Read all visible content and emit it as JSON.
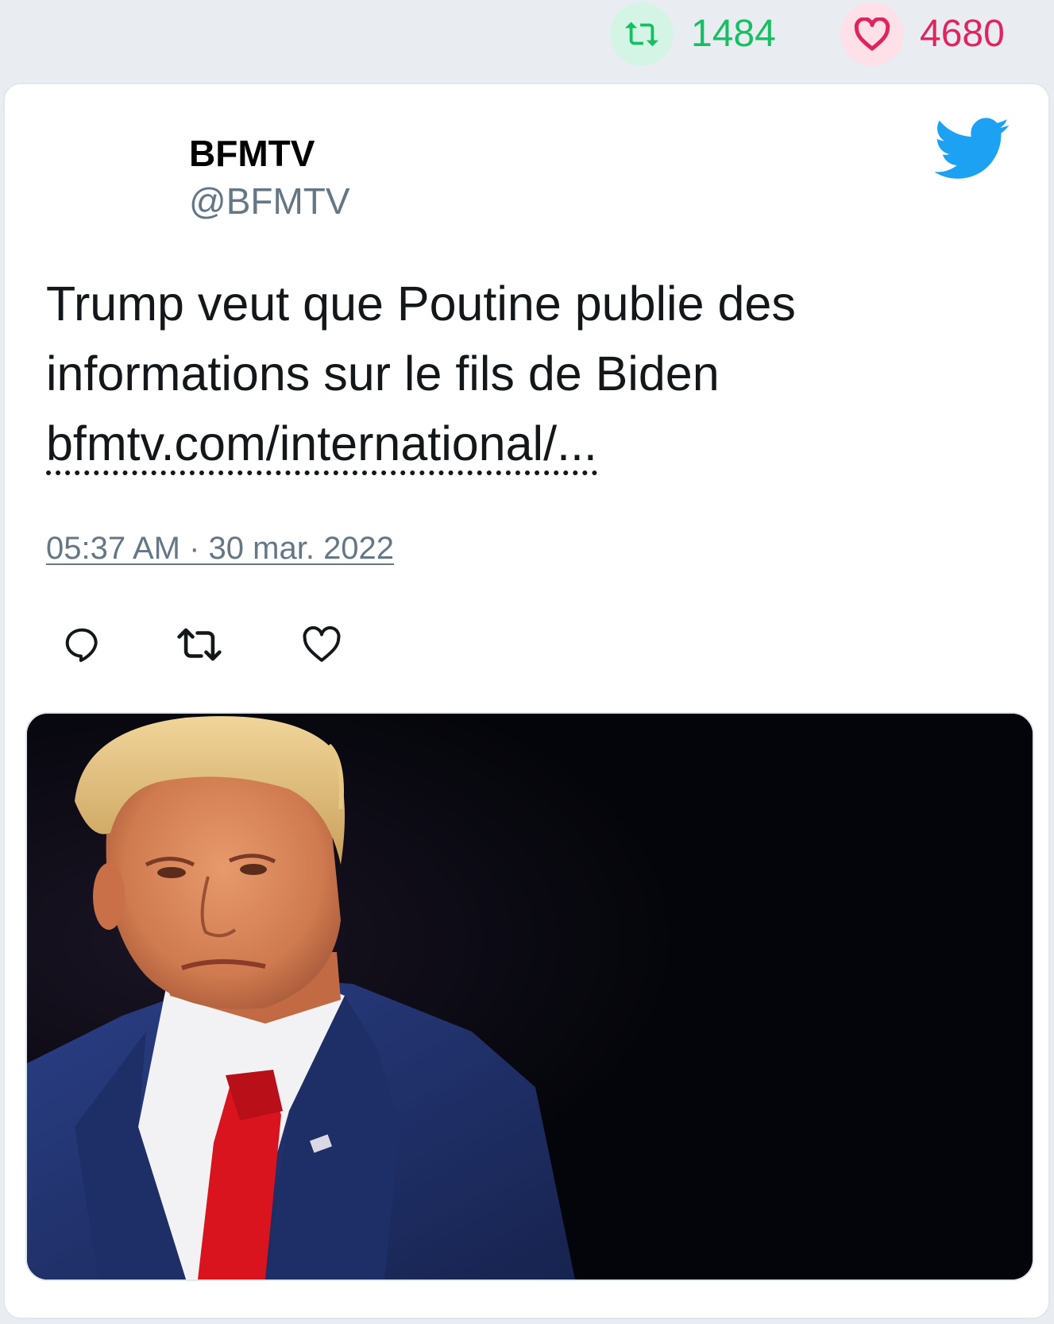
{
  "stats": {
    "retweets": "1484",
    "likes": "4680",
    "retweet_color": "#17bf63",
    "like_color": "#e0245e"
  },
  "tweet": {
    "display_name": "BFMTV",
    "handle": "@BFMTV",
    "text_line1": "Trump veut que Poutine publie des",
    "text_line2": "informations sur le fils de Biden",
    "link": "bfmtv.com/international/...",
    "timestamp": "05:37 AM · 30 mar. 2022"
  },
  "icons": {
    "brand": "twitter-bird-icon",
    "actions": [
      "reply-icon",
      "retweet-icon",
      "like-icon"
    ]
  },
  "colors": {
    "twitter_blue": "#1da1f2",
    "secondary_text": "#657786"
  }
}
